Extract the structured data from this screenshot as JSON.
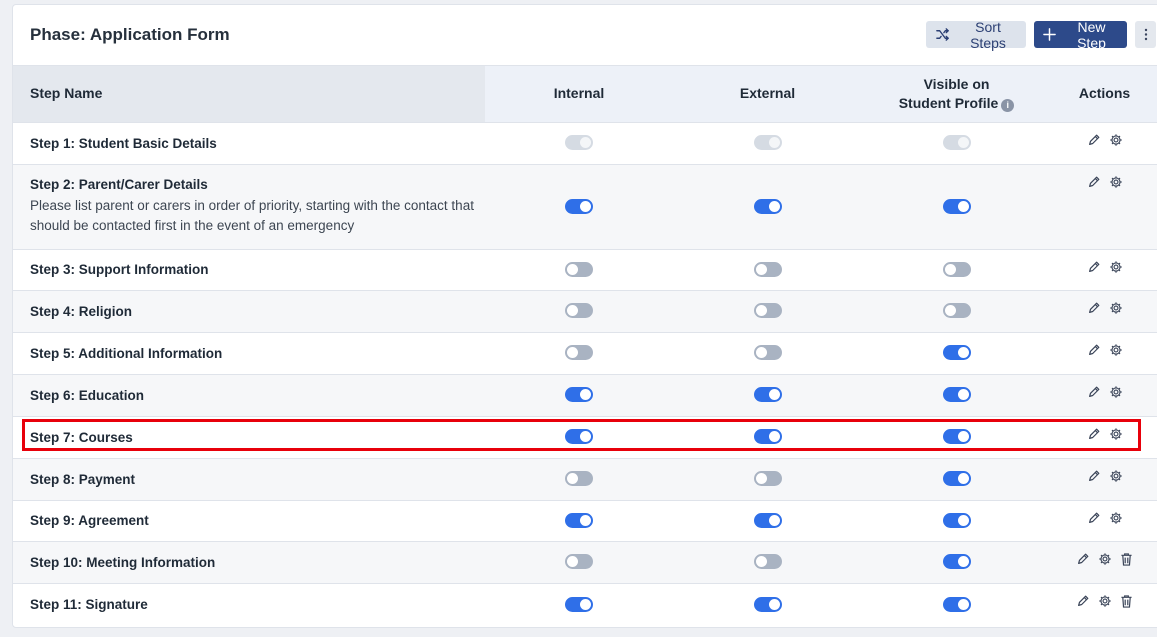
{
  "header": {
    "title": "Phase: Application Form",
    "sort_label": "Sort Steps",
    "new_label": "New Step"
  },
  "columns": {
    "name": "Step Name",
    "internal": "Internal",
    "external": "External",
    "visible_line1": "Visible on",
    "visible_line2": "Student Profile",
    "actions": "Actions"
  },
  "steps": [
    {
      "name": "Step 1: Student Basic Details",
      "desc": "",
      "internal": "disabled",
      "external": "disabled",
      "visible": "disabled",
      "deletable": false
    },
    {
      "name": "Step 2: Parent/Carer Details",
      "desc": "Please list parent or carers in order of priority, starting with the contact that should be contacted first in the event of an emergency",
      "internal": "on",
      "external": "on",
      "visible": "on",
      "deletable": false
    },
    {
      "name": "Step 3: Support Information",
      "desc": "",
      "internal": "off",
      "external": "off",
      "visible": "off",
      "deletable": false
    },
    {
      "name": "Step 4: Religion",
      "desc": "",
      "internal": "off",
      "external": "off",
      "visible": "off",
      "deletable": false
    },
    {
      "name": "Step 5: Additional Information",
      "desc": "",
      "internal": "off",
      "external": "off",
      "visible": "on",
      "deletable": false
    },
    {
      "name": "Step 6: Education",
      "desc": "",
      "internal": "on",
      "external": "on",
      "visible": "on",
      "deletable": false
    },
    {
      "name": "Step 7: Courses",
      "desc": "",
      "internal": "on",
      "external": "on",
      "visible": "on",
      "deletable": false,
      "highlighted": true
    },
    {
      "name": "Step 8: Payment",
      "desc": "",
      "internal": "off",
      "external": "off",
      "visible": "on",
      "deletable": false
    },
    {
      "name": "Step 9: Agreement",
      "desc": "",
      "internal": "on",
      "external": "on",
      "visible": "on",
      "deletable": false
    },
    {
      "name": "Step 10: Meeting Information",
      "desc": "",
      "internal": "off",
      "external": "off",
      "visible": "on",
      "deletable": true
    },
    {
      "name": "Step 11: Signature",
      "desc": "",
      "internal": "on",
      "external": "on",
      "visible": "on",
      "deletable": true
    }
  ],
  "colors": {
    "toggle_on": "#2f6fe8",
    "toggle_off": "#a9b3c2",
    "primary_button": "#2d4a8a",
    "highlight": "#e8000b"
  },
  "icons": {
    "sort": "shuffle-icon",
    "new": "plus-icon",
    "more": "kebab-icon",
    "edit": "pencil-icon",
    "settings": "gear-icon",
    "delete": "trash-icon",
    "info": "info-icon"
  }
}
